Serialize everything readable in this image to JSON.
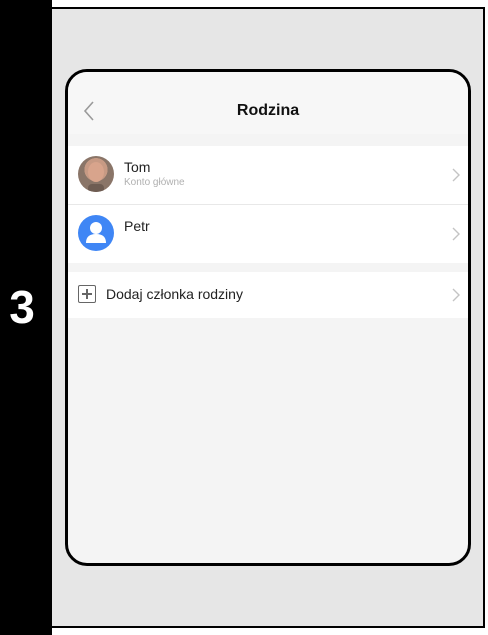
{
  "step": {
    "number": "3"
  },
  "screen": {
    "title": "Rodzina",
    "back_icon": "chevron-left-icon"
  },
  "members": [
    {
      "name": "Tom",
      "subtitle": "Konto główne",
      "avatar": "photo"
    },
    {
      "name": "Petr",
      "subtitle": "",
      "avatar": "default-user-icon"
    }
  ],
  "add_member": {
    "label": "Dodaj członka rodziny",
    "icon": "plus-square-icon"
  },
  "colors": {
    "accent": "#3f86f5",
    "background": "#f4f4f4",
    "panel": "#e6e6e6"
  }
}
